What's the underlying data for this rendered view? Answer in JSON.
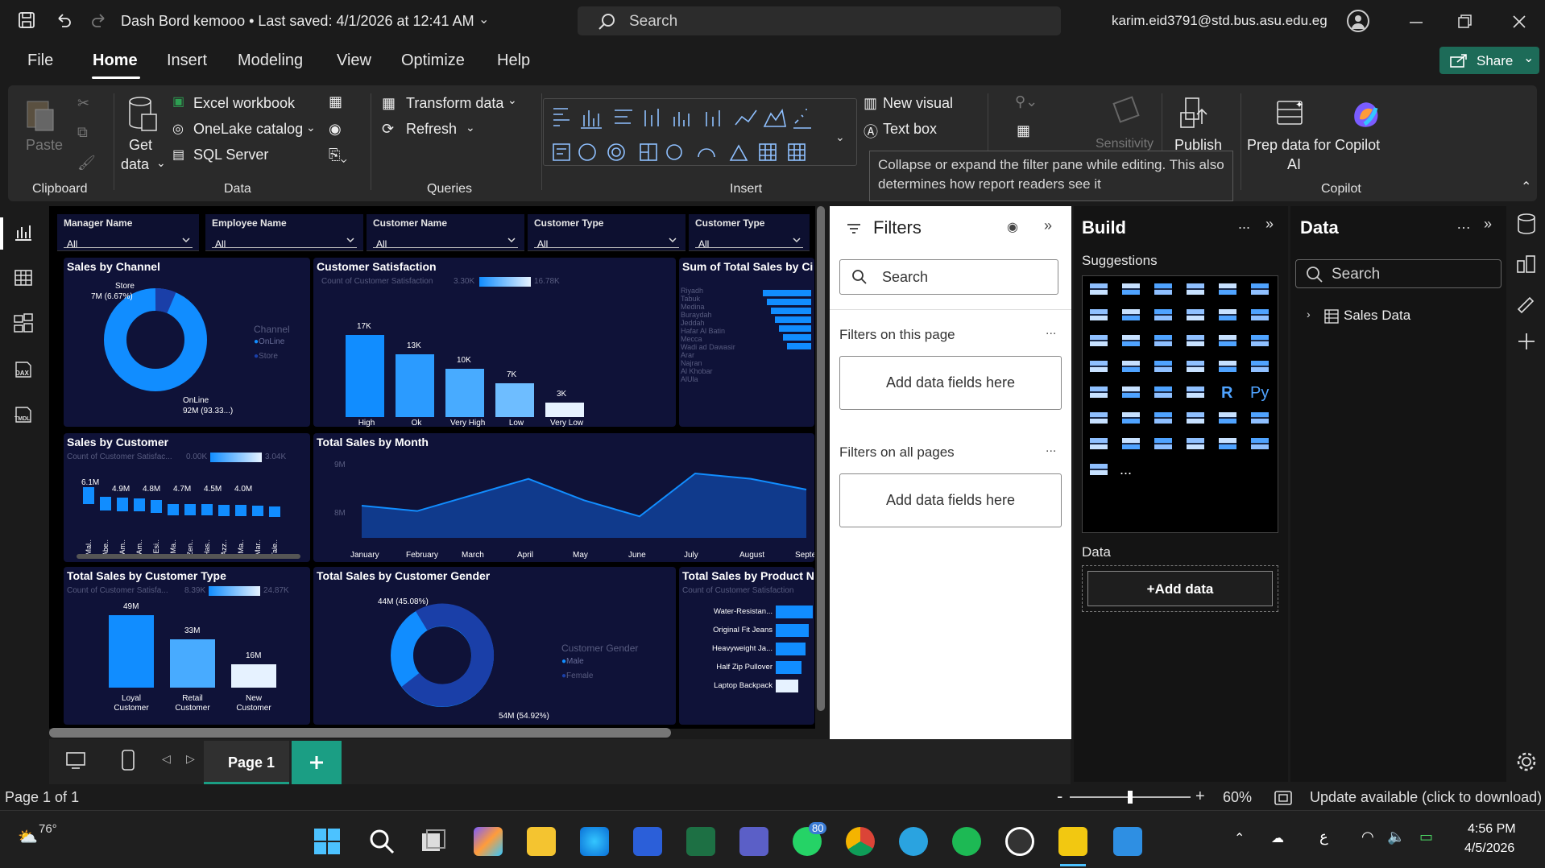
{
  "titlebar": {
    "doc_title": "Dash Bord kemooo • Last saved: 4/1/2026 at 12:41 AM",
    "search_placeholder": "Search",
    "user_email": "karim.eid3791@std.bus.asu.edu.eg"
  },
  "menu": {
    "file": "File",
    "home": "Home",
    "insert": "Insert",
    "modeling": "Modeling",
    "view": "View",
    "optimize": "Optimize",
    "help": "Help",
    "share": "Share"
  },
  "ribbon": {
    "paste": "Paste",
    "clipboard": "Clipboard",
    "get_data_1": "Get",
    "get_data_2": "data",
    "excel": "Excel workbook",
    "onelake": "OneLake catalog",
    "sql": "SQL Server",
    "data_group": "Data",
    "transform": "Transform data",
    "refresh": "Refresh",
    "queries": "Queries",
    "insert_group": "Insert",
    "new_visual": "New visual",
    "text_box": "Text box",
    "sensitivity": "Sensitivity",
    "publish": "Publish",
    "prep_1": "Prep data for Copilot",
    "prep_2": "AI",
    "copilot_group": "Copilot",
    "tooltip": "Collapse or expand the filter pane while editing. This also determines how report readers see it"
  },
  "slicers": [
    {
      "header": "Manager Name",
      "value": "All"
    },
    {
      "header": "Employee Name",
      "value": "All"
    },
    {
      "header": "Customer Name",
      "value": "All"
    },
    {
      "header": "Customer Type",
      "value": "All"
    },
    {
      "header": "Customer Type",
      "value": "All"
    }
  ],
  "tiles": {
    "sales_by_channel": {
      "title": "Sales by Channel",
      "legend_title": "Channel",
      "legend": [
        "OnLine",
        "Store"
      ],
      "store_label": "Store",
      "store_value": "7M (6.67%)",
      "online_label": "OnLine",
      "online_value": "92M (93.33...)"
    },
    "customer_satisfaction": {
      "title": "Customer Satisfaction",
      "filter_label": "Count of Customer Satisfaction",
      "min": "3.30K",
      "max": "16.78K"
    },
    "sum_total_sales_city": {
      "title": "Sum of Total Sales by Ci",
      "cities": [
        "Riyadh",
        "Tabuk",
        "Medina",
        "Buraydah",
        "Jeddah",
        "Hafar Al Batin",
        "Mecca",
        "Wadi ad Dawasir",
        "Arar",
        "Najran",
        "Al Khobar",
        "AlUla"
      ]
    },
    "sales_by_customer": {
      "title": "Sales by Customer",
      "filter_label": "Count of Customer Satisfac...",
      "min": "0.00K",
      "max": "3.04K"
    },
    "total_sales_month": {
      "title": "Total Sales by Month",
      "y_ticks": [
        "9M",
        "8M"
      ]
    },
    "total_sales_customer_type": {
      "title": "Total Sales by Customer Type",
      "filter_label": "Count of Customer Satisfa...",
      "min": "8.39K",
      "max": "24.87K"
    },
    "total_sales_gender": {
      "title": "Total Sales by Customer Gender",
      "legend_title": "Customer Gender",
      "legend": [
        "Male",
        "Female"
      ],
      "male_value": "44M (45.08%)",
      "female_value": "54M (54.92%)"
    },
    "total_sales_product": {
      "title": "Total Sales by Product N",
      "filter_label": "Count of Customer Satisfaction"
    }
  },
  "chart_data": [
    {
      "type": "pie",
      "title": "Sales by Channel",
      "categories": [
        "OnLine",
        "Store"
      ],
      "values": [
        92,
        7
      ],
      "unit": "M"
    },
    {
      "type": "bar",
      "title": "Customer Satisfaction",
      "categories": [
        "High",
        "Ok",
        "Very High",
        "Low",
        "Very Low"
      ],
      "values": [
        17,
        13,
        10,
        7,
        3
      ],
      "labels": [
        "17K",
        "13K",
        "10K",
        "7K",
        "3K"
      ]
    },
    {
      "type": "bar",
      "title": "Sales by Customer",
      "categories": [
        "Mal..",
        "Abe..",
        "Am..",
        "Am..",
        "Esi..",
        "Ma..",
        "Zen..",
        "Has..",
        "Azz..",
        "Ma..",
        "Mar..",
        "Tale.."
      ],
      "values": [
        6.1,
        4.9,
        4.8,
        4.7,
        4.5,
        4.0,
        4.0,
        4.0,
        3.9,
        3.9,
        3.8,
        3.7
      ],
      "labels": [
        "6.1M",
        "4.9M",
        "4.8M",
        "4.7M",
        "4.5M",
        "4.0M"
      ]
    },
    {
      "type": "area",
      "title": "Total Sales by Month",
      "x": [
        "January",
        "February",
        "March",
        "April",
        "May",
        "June",
        "July",
        "August",
        "Septembe"
      ],
      "values": [
        8.1,
        8.0,
        8.3,
        8.6,
        8.2,
        7.9,
        8.7,
        8.6,
        8.4
      ],
      "ylim": [
        7.5,
        9
      ]
    },
    {
      "type": "bar",
      "title": "Total Sales by Customer Type",
      "categories": [
        "Loyal Customer",
        "Retail Customer",
        "New Customer"
      ],
      "values": [
        49,
        33,
        16
      ],
      "labels": [
        "49M",
        "33M",
        "16M"
      ]
    },
    {
      "type": "pie",
      "title": "Total Sales by Customer Gender",
      "categories": [
        "Male",
        "Female"
      ],
      "values": [
        44,
        54
      ]
    },
    {
      "type": "bar",
      "title": "Total Sales by Product N",
      "categories": [
        "Water-Resistan...",
        "Original Fit Jeans",
        "Heavyweight Ja...",
        "Half Zip Pullover",
        "Laptop Backpack"
      ],
      "values": [
        10,
        9,
        8,
        7,
        6
      ]
    }
  ],
  "page": {
    "tab": "Page 1",
    "status": "Page 1 of 1",
    "zoom": "60%",
    "update": "Update available (click to download)"
  },
  "filters": {
    "title": "Filters",
    "search": "Search",
    "on_page": "Filters on this page",
    "on_all": "Filters on all pages",
    "add_fields": "Add data fields here",
    "add_fields_2": "Add data fields here",
    "more": "..."
  },
  "build": {
    "title": "Build",
    "suggestions": "Suggestions",
    "data_label": "Data",
    "add_data": "+Add data",
    "r": "R",
    "py": "Py",
    "more": "..."
  },
  "data_pane": {
    "title": "Data",
    "search": "Search",
    "table": "Sales Data"
  },
  "taskbar": {
    "weather": "76°",
    "badge": "80",
    "time": "4:56 PM",
    "date": "4/5/2026",
    "lang": "ع"
  },
  "colors": {
    "accent": "#1b9e84",
    "canvas_tile": "#0f1238",
    "bar_blue": "#118dff"
  }
}
